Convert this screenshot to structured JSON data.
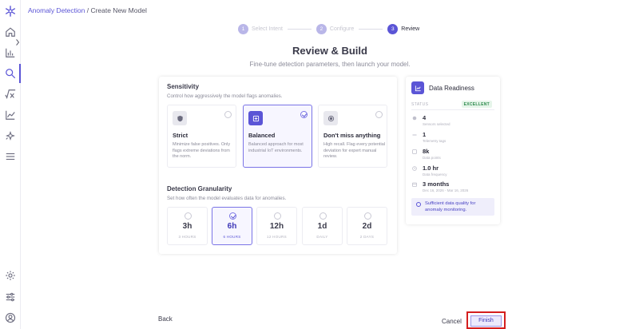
{
  "breadcrumb": {
    "link": "Anomaly Detection",
    "separator": " / ",
    "current": "Create New Model"
  },
  "stepper": [
    {
      "num": "1",
      "label": "Select Intent",
      "state": "done"
    },
    {
      "num": "2",
      "label": "Configure",
      "state": "done"
    },
    {
      "num": "3",
      "label": "Review",
      "state": "current"
    }
  ],
  "page": {
    "title": "Review & Build",
    "subtitle": "Fine-tune detection parameters, then launch your model."
  },
  "sensitivity": {
    "title": "Sensitivity",
    "subtitle": "Control how aggressively the model flags anomalies.",
    "options": [
      {
        "name": "Strict",
        "desc": "Minimize false positives. Only flags extreme deviations from the norm.",
        "icon": "shield-icon",
        "selected": false
      },
      {
        "name": "Balanced",
        "desc": "Balanced approach for most industrial IoT environments.",
        "icon": "balance-icon",
        "selected": true
      },
      {
        "name": "Don't miss anything",
        "desc": "High recall. Flag every potential deviation for expert manual review.",
        "icon": "target-icon",
        "selected": false
      }
    ]
  },
  "granularity": {
    "title": "Detection Granularity",
    "subtitle": "Set how often the model evaluates data for anomalies.",
    "options": [
      {
        "value": "3h",
        "unit": "3 HOURS",
        "selected": false
      },
      {
        "value": "6h",
        "unit": "6 HOURS",
        "selected": true
      },
      {
        "value": "12h",
        "unit": "12 HOURS",
        "selected": false
      },
      {
        "value": "1d",
        "unit": "DAILY",
        "selected": false
      },
      {
        "value": "2d",
        "unit": "2 DAYS",
        "selected": false
      }
    ]
  },
  "readiness": {
    "title": "Data Readiness",
    "status_label": "STATUS",
    "status_value": "EXCELLENT",
    "metrics": [
      {
        "value": "4",
        "label": "Sensors selected"
      },
      {
        "value": "1",
        "label": "Telemetry tags"
      },
      {
        "value": "8k",
        "label": "Data points"
      },
      {
        "value": "1.0 hr",
        "label": "Data frequency"
      },
      {
        "value": "3 months",
        "label": "Dec 16, 2026 - Mar 16, 2026"
      }
    ],
    "note": "Sufficient data quality for anomaly monitoring."
  },
  "footer": {
    "back": "Back",
    "cancel": "Cancel",
    "finish": "Finish"
  },
  "colors": {
    "accent": "#5b55d6",
    "highlight": "#d41f1f",
    "success": "#2e8b4e"
  }
}
